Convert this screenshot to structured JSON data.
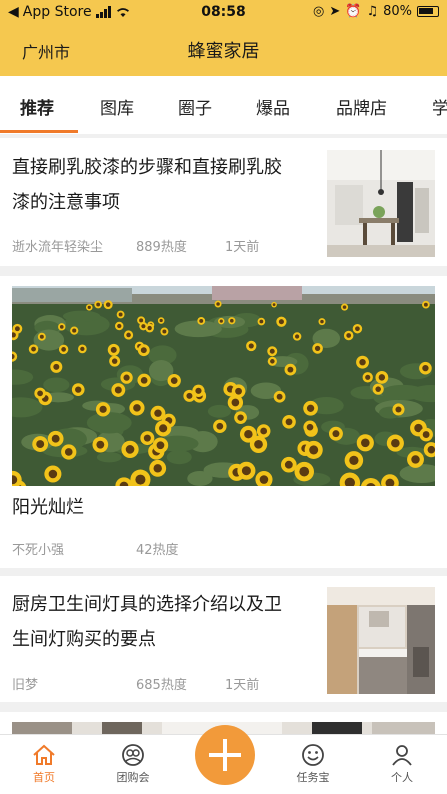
{
  "status_bar": {
    "back_app": "App Store",
    "time": "08:58",
    "battery": "80%"
  },
  "header": {
    "city": "广州市",
    "title": "蜂蜜家居"
  },
  "tabs": [
    "推荐",
    "图库",
    "圈子",
    "爆品",
    "品牌店",
    "学"
  ],
  "feed": [
    {
      "title_line1": "直接刷乳胶漆的步骤和直接刷乳胶",
      "title_line2": "漆的注意事项",
      "author": "逝水流年轻染尘",
      "heat": "889热度",
      "time": "1天前"
    },
    {
      "title": "阳光灿烂",
      "author": "不死小强",
      "heat": "42热度"
    },
    {
      "title_line1": "厨房卫生间灯具的选择介绍以及卫",
      "title_line2": "生间灯购买的要点",
      "author": "旧梦",
      "heat": "685热度",
      "time": "1天前"
    }
  ],
  "tabbar": {
    "home": "首页",
    "group_buy": "团购会",
    "tasks": "任务宝",
    "profile": "个人"
  },
  "colors": {
    "brand_yellow": "#f5c84f",
    "accent_orange": "#f07a2a",
    "meta_gray": "#999999"
  }
}
